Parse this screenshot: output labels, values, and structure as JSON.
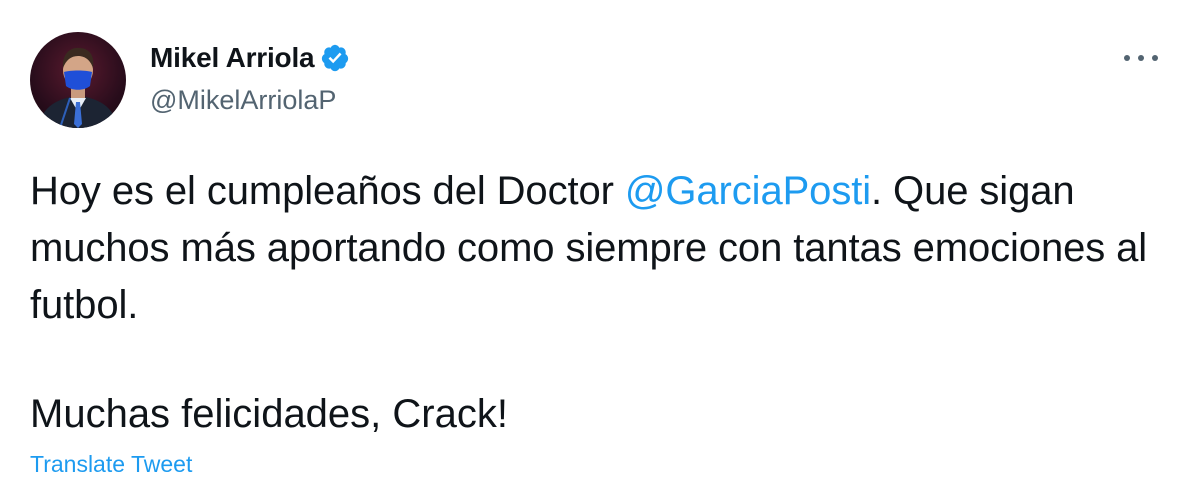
{
  "user": {
    "name": "Mikel Arriola",
    "handle": "@MikelArriolaP",
    "verified": true,
    "avatar_icon": "profile-photo"
  },
  "tweet": {
    "line1_before": "Hoy es el cumpleaños del Doctor ",
    "mention": "@GarciaPosti",
    "line1_after": ". Que sigan muchos más aportando como siempre con tantas emociones al futbol.",
    "paragraph2": "Muchas felicidades, Crack!"
  },
  "actions": {
    "translate_label": "Translate Tweet",
    "more_icon": "more-horizontal-icon"
  },
  "colors": {
    "accent": "#1d9bf0",
    "text": "#0f1419",
    "secondary": "#536471"
  }
}
